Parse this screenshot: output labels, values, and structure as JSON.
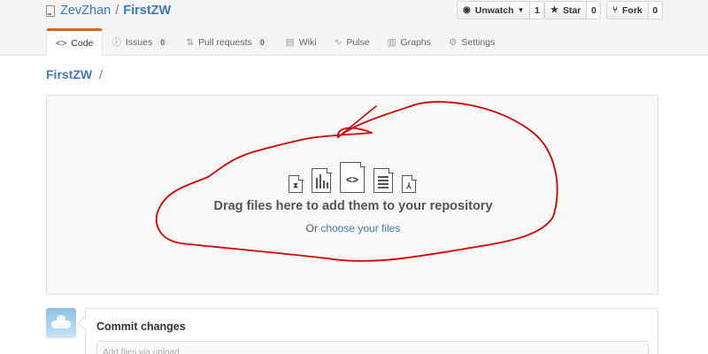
{
  "header": {
    "owner": "ZevZhan",
    "separator": "/",
    "repo": "FirstZW",
    "actions": [
      {
        "label": "Unwatch",
        "icon": "eye-icon",
        "count": "1"
      },
      {
        "label": "Star",
        "icon": "star-icon",
        "count": "0"
      },
      {
        "label": "Fork",
        "icon": "fork-icon",
        "count": "0"
      }
    ]
  },
  "tabs": [
    {
      "label": "Code",
      "icon": "code-icon",
      "selected": true
    },
    {
      "label": "Issues",
      "icon": "issue-icon",
      "count": "0"
    },
    {
      "label": "Pull requests",
      "icon": "pull-request-icon",
      "count": "0"
    },
    {
      "label": "Wiki",
      "icon": "book-icon"
    },
    {
      "label": "Pulse",
      "icon": "pulse-icon"
    },
    {
      "label": "Graphs",
      "icon": "graph-icon"
    },
    {
      "label": "Settings",
      "icon": "gear-icon"
    }
  ],
  "breadcrumb": {
    "repo": "FirstZW",
    "separator": "/"
  },
  "dropzone": {
    "file_icons": [
      "zip-file-icon",
      "chart-file-icon",
      "code-file-icon",
      "text-file-icon",
      "pdf-file-icon"
    ],
    "title": "Drag files here to add them to your repository",
    "prefix": "Or",
    "link": "choose your files"
  },
  "commit": {
    "title": "Commit changes",
    "placeholder": "Add files via upload"
  },
  "annotation_color": "#d40000"
}
